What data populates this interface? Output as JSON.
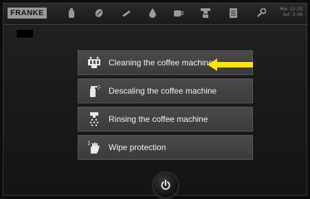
{
  "header": {
    "brand": "FRANKE",
    "clock_line1": "Mon 12:33",
    "clock_line2": "Sat 3:06"
  },
  "nav_icons": [
    "bottle-icon",
    "bean-icon",
    "tool-icon",
    "drop-icon",
    "cup-icon",
    "coffee-machine-icon",
    "document-icon",
    "wrench-icon"
  ],
  "menu": {
    "items": [
      {
        "label": "Cleaning the coffee machine",
        "icon": "cleaning-icon"
      },
      {
        "label": "Descaling the coffee machine",
        "icon": "spray-bottle-icon"
      },
      {
        "label": "Rinsing the coffee machine",
        "icon": "rinse-icon"
      },
      {
        "label": "Wipe protection",
        "icon": "wipe-hand-icon"
      }
    ]
  },
  "colors": {
    "background": "#0d0d0d",
    "menu_item": "#444444",
    "text": "#f2f2f2",
    "highlight_arrow": "#ffe600"
  },
  "power_button": {
    "icon": "power-icon"
  }
}
